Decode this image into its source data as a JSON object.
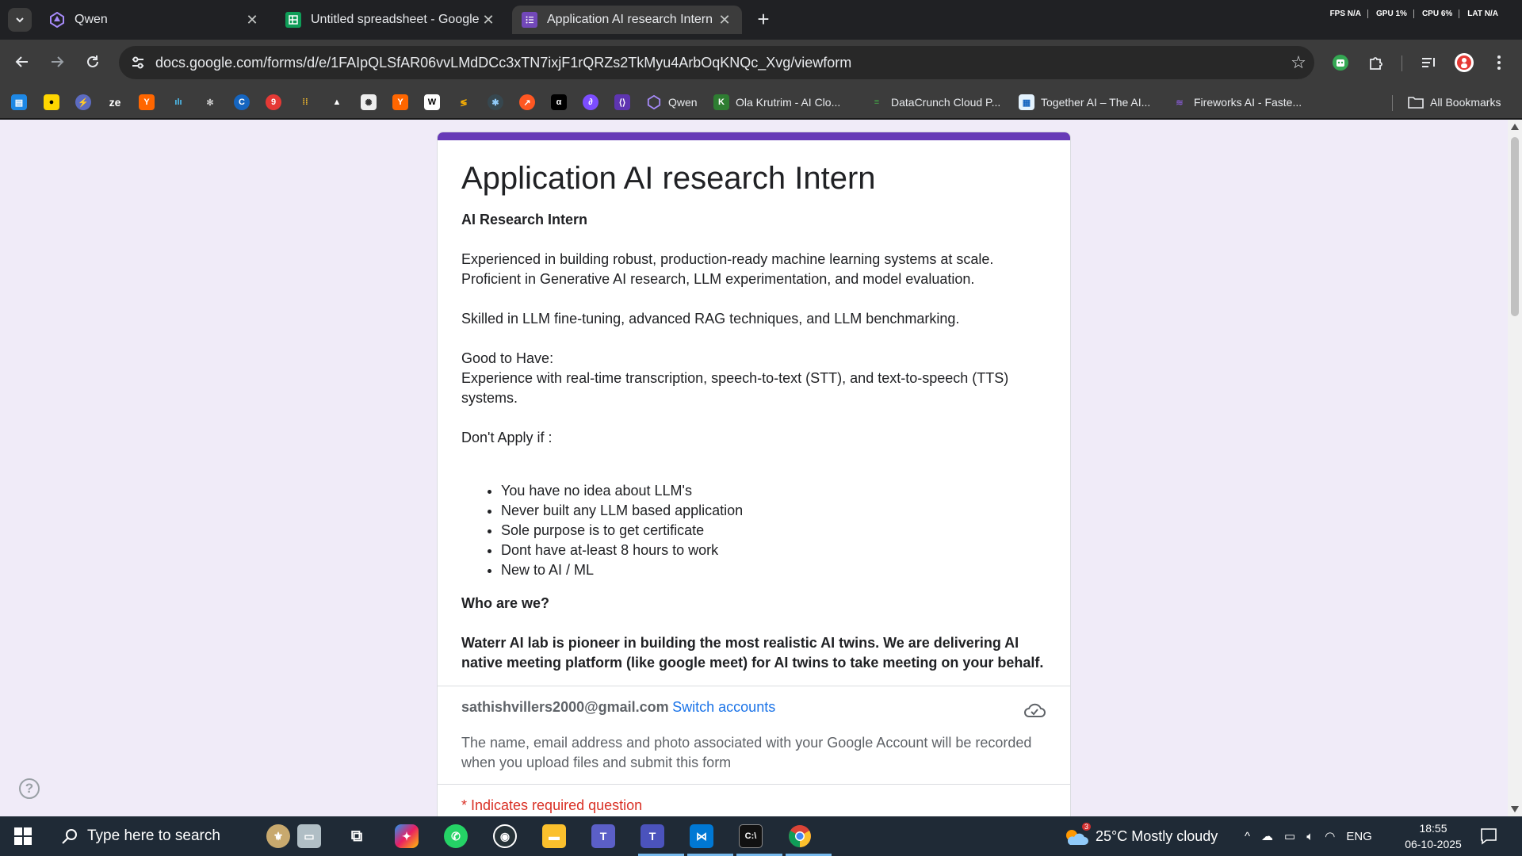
{
  "browser": {
    "tabs": [
      {
        "title": "Qwen",
        "active": false
      },
      {
        "title": "Untitled spreadsheet - Google Sheets",
        "active": false
      },
      {
        "title": "Application AI research Intern",
        "active": true
      }
    ],
    "perf": [
      "FPS N/A",
      "GPU 1%",
      "CPU 6%",
      "LAT N/A"
    ],
    "url": "docs.google.com/forms/d/e/1FAIpQLSfAR06vvLMdDCc3xTN7ixjF1rQRZs2TkMyu4ArbOqKNQc_Xvg/viewform",
    "bookmarks": [
      {
        "label": "Qwen"
      },
      {
        "label": "Ola Krutrim - AI Clo..."
      },
      {
        "label": "DataCrunch Cloud P..."
      },
      {
        "label": "Together AI – The AI..."
      },
      {
        "label": "Fireworks AI - Faste..."
      }
    ],
    "all_bookmarks": "All Bookmarks"
  },
  "form": {
    "title": "Application AI research Intern",
    "subtitle": "AI Research Intern",
    "para1_line1": "Experienced in building robust, production-ready machine learning systems at scale.",
    "para1_line2": "Proficient in Generative AI research, LLM experimentation, and model evaluation.",
    "para2": "Skilled in LLM fine-tuning, advanced RAG techniques, and LLM benchmarking.",
    "good_heading": "Good to Have:",
    "good_text": "Experience with real-time transcription, speech-to-text (STT), and text-to-speech (TTS) systems.",
    "dont_heading": "Don't Apply if :",
    "dont_items": [
      "You have no idea about LLM's",
      "Never built any LLM based application",
      "Sole purpose is to get certificate",
      "Dont have at-least 8 hours to work",
      "New to AI / ML"
    ],
    "who_heading": "Who are we?",
    "who_text": "Waterr AI lab is pioneer in building the most realistic AI twins. We are delivering AI native meeting platform (like google meet) for AI twins to take meeting on your behalf.",
    "account_email": "sathishvillers2000@gmail.com",
    "switch_label": "Switch accounts",
    "account_note": "The name, email address and photo associated with your Google Account will be recorded when you upload files and submit this form",
    "required_note": "* Indicates required question"
  },
  "taskbar": {
    "search_placeholder": "Type here to search",
    "weather_badge": "3",
    "weather": "25°C  Mostly cloudy",
    "lang": "ENG",
    "time": "18:55",
    "date": "06-10-2025"
  },
  "colors": {
    "form_accent": "#673ab7",
    "page_bg": "#f0ebf8",
    "link": "#1a73e8",
    "required": "#d93025"
  }
}
